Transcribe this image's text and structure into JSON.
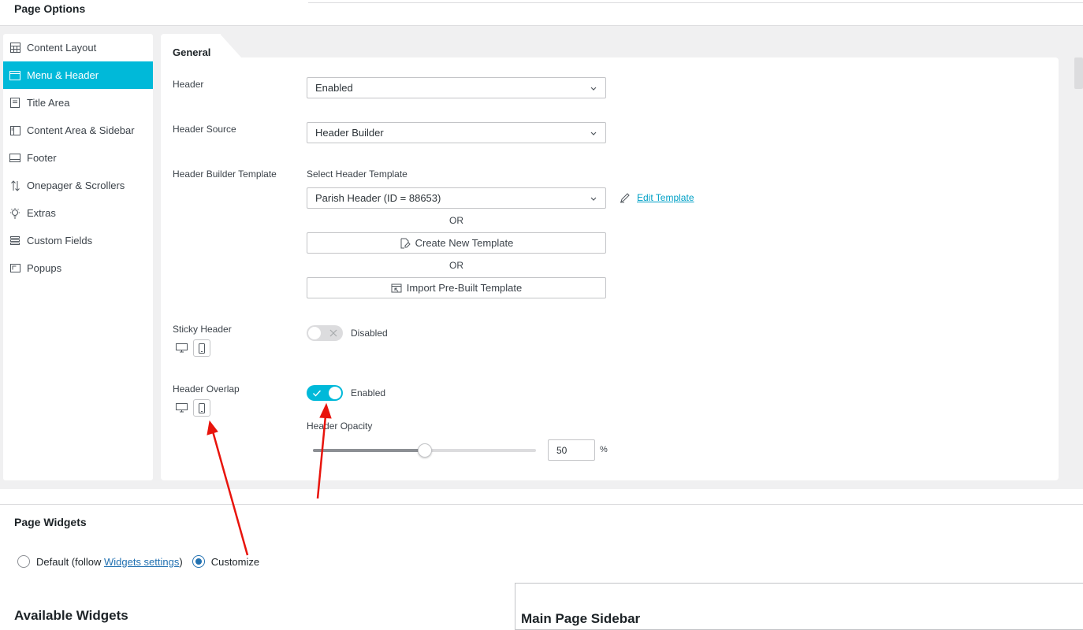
{
  "page_options": {
    "title": "Page Options"
  },
  "nav": {
    "items": [
      {
        "label": "Content Layout",
        "icon": "grid-icon",
        "active": false
      },
      {
        "label": "Menu & Header",
        "icon": "window-header-icon",
        "active": true
      },
      {
        "label": "Title Area",
        "icon": "document-text-icon",
        "active": false
      },
      {
        "label": "Content Area & Sidebar",
        "icon": "sidebar-layout-icon",
        "active": false
      },
      {
        "label": "Footer",
        "icon": "footer-layout-icon",
        "active": false
      },
      {
        "label": "Onepager & Scrollers",
        "icon": "up-down-arrows-icon",
        "active": false
      },
      {
        "label": "Extras",
        "icon": "lightbulb-icon",
        "active": false
      },
      {
        "label": "Custom Fields",
        "icon": "list-lines-icon",
        "active": false
      },
      {
        "label": "Popups",
        "icon": "popup-window-icon",
        "active": false
      }
    ],
    "accent_color": "#00b9d9"
  },
  "panel": {
    "tab_label": "General",
    "header": {
      "label": "Header",
      "value": "Enabled"
    },
    "header_source": {
      "label": "Header Source",
      "value": "Header Builder"
    },
    "header_builder_template": {
      "label": "Header Builder Template",
      "select_label": "Select Header Template",
      "value": "Parish Header (ID = 88653)",
      "edit_link": "Edit Template",
      "or_1": "OR",
      "create_button": "Create New Template",
      "or_2": "OR",
      "import_button": "Import Pre-Built Template"
    },
    "sticky_header": {
      "label": "Sticky Header",
      "state": "Disabled",
      "enabled": false
    },
    "header_overlap": {
      "label": "Header Overlap",
      "state": "Enabled",
      "enabled": true
    },
    "header_opacity": {
      "label": "Header Opacity",
      "value": "50",
      "unit": "%",
      "percent": 50
    }
  },
  "page_widgets": {
    "title": "Page Widgets",
    "default_prefix": "Default (follow ",
    "default_link": "Widgets settings",
    "default_suffix": ")",
    "customize_label": "Customize",
    "selected": "customize"
  },
  "available_widgets": {
    "title": "Available Widgets"
  },
  "main_sidebar": {
    "title": "Main Page Sidebar"
  }
}
